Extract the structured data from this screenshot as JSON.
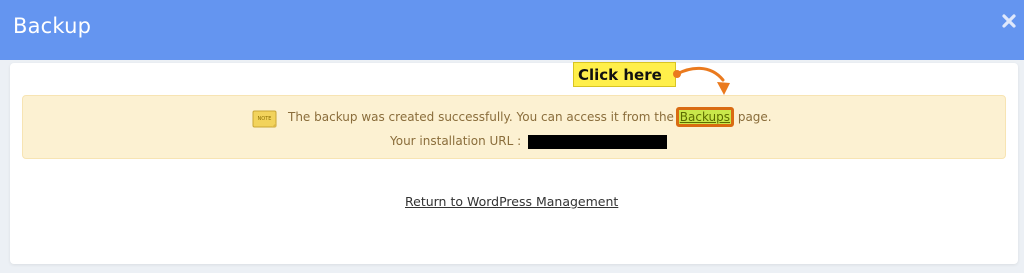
{
  "dialog": {
    "title": "Backup",
    "close_icon": "close-icon"
  },
  "alert": {
    "icon": "note-icon",
    "icon_text": "NOTE",
    "message_before": "The backup was created successfully. You can access it from the ",
    "link_label": "Backups",
    "message_after": " page.",
    "url_label": "Your installation URL : ",
    "url_redacted": true
  },
  "annotation": {
    "callout_label": "Click here",
    "highlight_color": "#c9e84a",
    "border_color": "#d96b12",
    "callout_bg": "#ffef4a"
  },
  "footer": {
    "return_link": "Return to WordPress Management"
  },
  "colors": {
    "header": "#6495f0",
    "alert_bg": "#fcf1d2",
    "alert_text": "#8a6d3b"
  }
}
